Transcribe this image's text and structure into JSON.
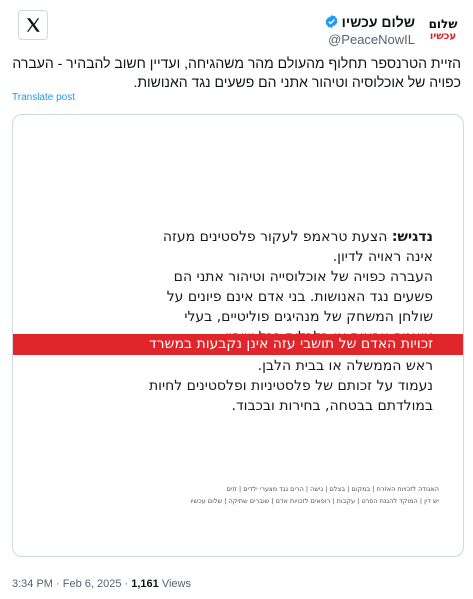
{
  "author": {
    "display_name": "שלום עכשיו",
    "handle": "@PeaceNowIL",
    "avatar_line1": "שלום",
    "avatar_line2": "עכשיו",
    "verified_color": "#1d9bf0"
  },
  "tweet_text": "הזיית הטרנספר תחלוף מהעולם מהר משהגיחה, ועדיין חשוב להבהיר - העברה כפויה של אוכלוסיה וטיהור אתני הם פשעים נגד האנושות.",
  "translate_label": "Translate post",
  "image": {
    "lines": [
      {
        "bold": "נדגיש:",
        "text": " הצעת טראמפ לעקור פלסטינים מעזה"
      },
      {
        "bold": "",
        "text": "אינה ראויה לדיון."
      },
      {
        "bold": "",
        "text": "העברה כפויה של אוכלוסייה וטיהור אתני הם"
      },
      {
        "bold": "",
        "text": "פשעים נגד האנושות. בני אדם אינם פיונים על"
      },
      {
        "bold": "",
        "text": "שולחן המשחק של מנהיגים פוליטיים, בעלי"
      },
      {
        "bold": "",
        "text": "עוצמה צבאית או כלכלית ככל שיהיו."
      }
    ],
    "highlight_line": "זכויות האדם של תושבי עזה אינן נקבעות במשרד",
    "after_lines": [
      "ראש הממשלה או בבית הלבן.",
      "נעמוד על זכותם של פלסטיניות ופלסטינים לחיות",
      "במולדתם בבטחה, בחירות ובכבוד."
    ],
    "highlight_color": "#e1262b",
    "partners_row1": "האגודה לזכויות האזרח | במקום | בצלם | גישה | הרים נגד מצערי ילדים | זזים",
    "partners_row2": "יש דין | המוקד להגנת הפרט | עקבות | רופאים לזכויות אדם | שוברים שתיקה | שלום עכשיו"
  },
  "meta": {
    "time_date": "3:34 PM · Feb 6, 2025 · ",
    "views_count": "1,161",
    "views_label": " Views"
  },
  "icons": [
    "x-logo-icon",
    "verified-badge-icon"
  ]
}
